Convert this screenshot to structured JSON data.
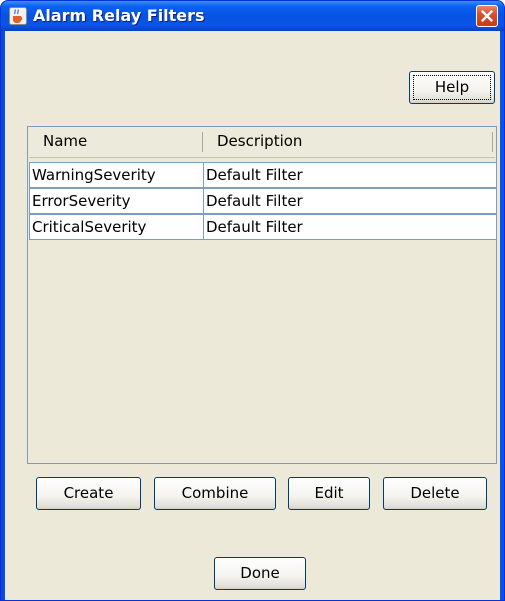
{
  "window": {
    "title": "Alarm Relay Filters"
  },
  "icons": {
    "app": "java-cup-icon",
    "close": "close-icon"
  },
  "buttons": {
    "help": "Help",
    "create": "Create",
    "combine": "Combine",
    "edit": "Edit",
    "delete": "Delete",
    "done": "Done"
  },
  "table": {
    "columns": [
      "Name",
      "Description"
    ],
    "rows": [
      {
        "name": "WarningSeverity",
        "description": "Default Filter"
      },
      {
        "name": "ErrorSeverity",
        "description": "Default Filter"
      },
      {
        "name": "CriticalSeverity",
        "description": "Default Filter"
      }
    ]
  },
  "colors": {
    "titlebar": "#0554e4",
    "dialog_background": "#ece9d8",
    "close_button": "#d9502e",
    "button_border": "#003c74"
  }
}
